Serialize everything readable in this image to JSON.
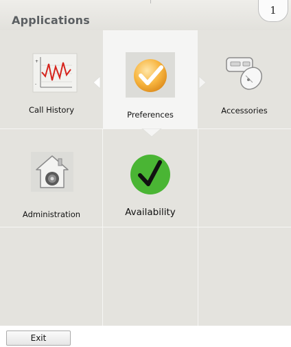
{
  "header": {
    "title": "Applications",
    "badge": "1"
  },
  "apps": [
    {
      "label": "Call History",
      "icon": "call-history-graph-icon"
    },
    {
      "label": "Preferences",
      "icon": "preferences-checkmark-icon",
      "selected": true
    },
    {
      "label": "Accessories",
      "icon": "accessories-mouse-icon"
    },
    {
      "label": "Administration",
      "icon": "administration-house-lock-icon"
    },
    {
      "label": "Availability",
      "icon": "availability-green-check-icon"
    }
  ],
  "footer": {
    "exit_label": "Exit"
  },
  "colors": {
    "panel": "#e4e3de",
    "selected_cell": "#f5f5f4",
    "availability_green": "#4ab534",
    "title_text": "#5b5f62"
  }
}
